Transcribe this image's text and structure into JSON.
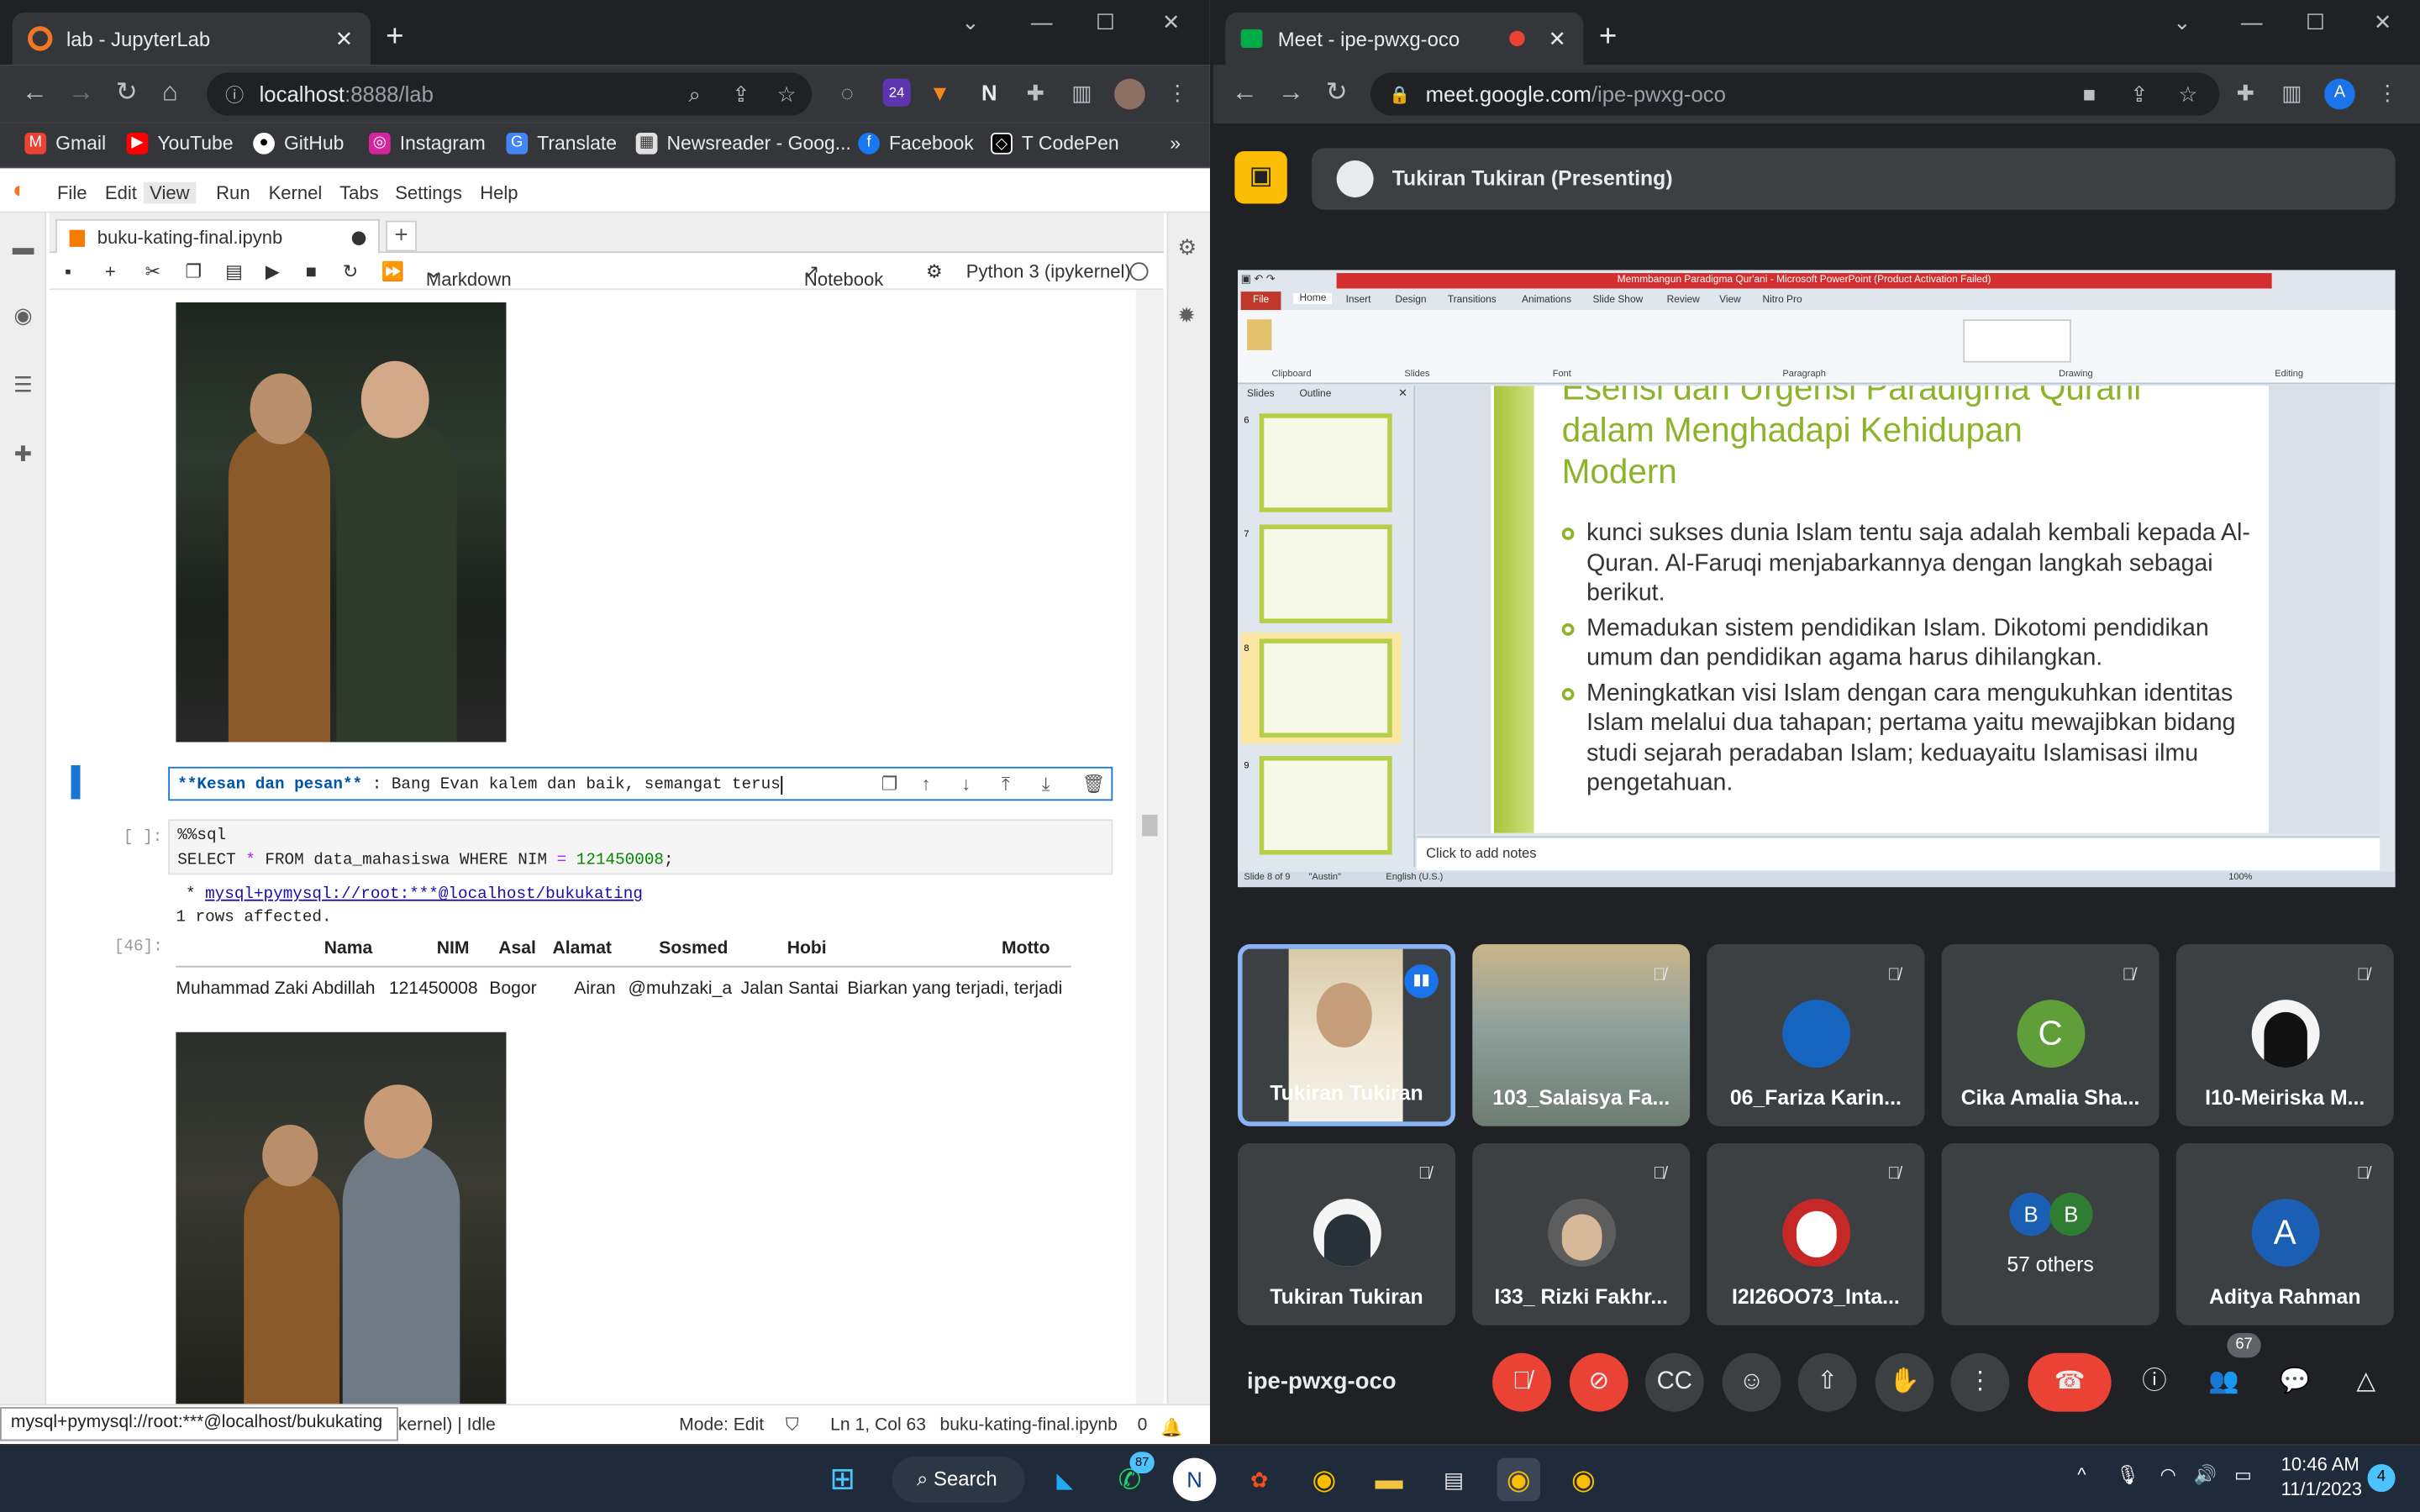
{
  "left_window": {
    "tab_title": "lab - JupyterLab",
    "url_host": "localhost",
    "url_rest": ":8888/lab",
    "extension_badge": "24",
    "bookmarks": [
      "Gmail",
      "YouTube",
      "GitHub",
      "Instagram",
      "Translate",
      "Newsreader - Goog...",
      "Facebook",
      "T CodePen"
    ],
    "bookmarks_more": "»"
  },
  "jupyter": {
    "menu": [
      "File",
      "Edit",
      "View",
      "Run",
      "Kernel",
      "Tabs",
      "Settings",
      "Help"
    ],
    "doc_tab": "buku-kating-final.ipynb",
    "cell_type": "Markdown",
    "notebook_link": "Notebook",
    "kernel": "Python 3 (ipykernel)",
    "editing_cell": {
      "bold": "**Kesan dan pesan**",
      "text": " : Bang Evan kalem dan baik, semangat terus"
    },
    "code_prompt": "[ ]:",
    "code_line1": "%%sql",
    "code_line2_a": "SELECT ",
    "code_line2_star": "*",
    "code_line2_b": " FROM data_mahasiswa WHERE NIM ",
    "code_line2_eq": "=",
    "code_line2_num": "121450008",
    "code_line2_end": ";",
    "conn_prefix": " * ",
    "conn_link": "mysql+pymysql://root:***@localhost/bukukating",
    "rows_affected": "1 rows affected.",
    "out_prompt": "[46]:",
    "table_headers": [
      "Nama",
      "NIM",
      "Asal",
      "Alamat",
      "Sosmed",
      "Hobi",
      "Motto"
    ],
    "table_row": [
      "Muhammad Zaki Abdillah",
      "121450008",
      "Bogor",
      "Airan",
      "@muhzaki_a",
      "Jalan Santai",
      "Biarkan yang terjadi, terjadi"
    ],
    "status_kernel_tail": "kernel) | Idle",
    "status_mode": "Mode: Edit",
    "status_pos": "Ln 1, Col 63",
    "status_file": "buku-kating-final.ipynb",
    "status_zero": "0",
    "tooltip": "mysql+pymysql://root:***@localhost/bukukating"
  },
  "right_window": {
    "tab_title": "Meet - ipe-pwxg-oco",
    "url_host": "meet.google.com",
    "url_rest": "/ipe-pwxg-oco",
    "profile_letter": "A",
    "presenter": "Tukiran Tukiran (Presenting)",
    "meeting_code": "ipe-pwxg-oco",
    "people_count": "67"
  },
  "slide": {
    "ppt_window_title": "Memmbangun Paradigma Qur'ani  -  Microsoft PowerPoint (Product Activation Failed)",
    "ribbon_tabs": [
      "File",
      "Home",
      "Insert",
      "Design",
      "Transitions",
      "Animations",
      "Slide Show",
      "Review",
      "View",
      "Nitro Pro"
    ],
    "ribbon_groups": [
      "Clipboard",
      "Slides",
      "Font",
      "Paragraph",
      "Drawing",
      "Editing"
    ],
    "panel_tabs": [
      "Slides",
      "Outline"
    ],
    "thumb_numbers": [
      "6",
      "7",
      "8",
      "9"
    ],
    "title_line1": "Esensi dan Urgensi Paradigma Qurani",
    "title_line2": "dalam Menghadapi Kehidupan",
    "title_line3": "Modern",
    "bullets": [
      "kunci sukses dunia Islam tentu saja adalah kembali kepada Al-Quran. Al-Faruqi menjabarkannya dengan langkah sebagai berikut.",
      "Memadukan sistem pendidikan Islam. Dikotomi pendidikan umum dan pendidikan agama harus dihilangkan.",
      "Meningkatkan visi Islam dengan cara mengukuhkan identitas Islam melalui dua tahapan; pertama yaitu mewajibkan bidang studi sejarah peradaban Islam; keduayaitu Islamisasi ilmu pengetahuan."
    ],
    "notes": "Click to add notes",
    "status_slide": "Slide 8 of 9",
    "status_theme": "\"Austin\"",
    "status_lang": "English (U.S.)",
    "zoom": "100%"
  },
  "participants": [
    {
      "name": "Tukiran Tukiran",
      "kind": "video"
    },
    {
      "name": "103_Salaisya Fa...",
      "kind": "video"
    },
    {
      "name": "06_Fariza Karin...",
      "kind": "photo",
      "color": "#1565c0"
    },
    {
      "name": "Cika Amalia Sha...",
      "kind": "letter",
      "letter": "C",
      "color": "#5f9e38"
    },
    {
      "name": "I10-Meiriska M...",
      "kind": "photo",
      "color": "#222222"
    },
    {
      "name": "Tukiran Tukiran",
      "kind": "photo",
      "color": "#263238"
    },
    {
      "name": "I33_ Rizki Fakhr...",
      "kind": "photo",
      "color": "#3e3e3e"
    },
    {
      "name": "I2I26OO73_Inta...",
      "kind": "photo",
      "color": "#c62828"
    },
    {
      "name": "57 others",
      "kind": "others",
      "letters": [
        "B",
        "B"
      ]
    },
    {
      "name": "Aditya Rahman",
      "kind": "letter",
      "letter": "A",
      "color": "#1a5fb4"
    }
  ],
  "taskbar": {
    "search": "Search",
    "whatsapp_badge": "87",
    "time": "10:46 AM",
    "date": "11/1/2023",
    "notif": "4"
  }
}
